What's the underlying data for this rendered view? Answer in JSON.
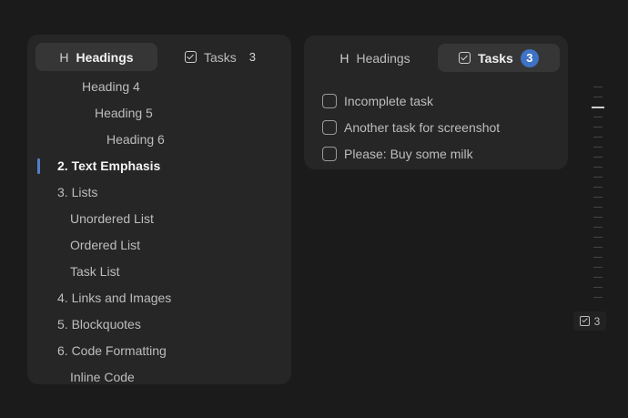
{
  "left_panel": {
    "tabs": [
      {
        "label": "Headings",
        "icon": "heading-icon",
        "glyph": "H",
        "active": true
      },
      {
        "label": "Tasks",
        "icon": "checkbox-icon",
        "count": "3",
        "active": false
      }
    ],
    "outline": [
      {
        "label": "Heading 4",
        "level": 4
      },
      {
        "label": "Heading 5",
        "level": 5
      },
      {
        "label": "Heading 6",
        "level": 6
      },
      {
        "label": "2. Text Emphasis",
        "level": 1,
        "current": true
      },
      {
        "label": "3. Lists",
        "level": 1
      },
      {
        "label": "Unordered List",
        "level": 2
      },
      {
        "label": "Ordered List",
        "level": 2
      },
      {
        "label": "Task List",
        "level": 2
      },
      {
        "label": "4. Links and Images",
        "level": 1
      },
      {
        "label": "5. Blockquotes",
        "level": 1
      },
      {
        "label": "6. Code Formatting",
        "level": 1
      },
      {
        "label": "Inline Code",
        "level": 2
      }
    ]
  },
  "right_panel": {
    "tabs": [
      {
        "label": "Headings",
        "icon": "heading-icon",
        "glyph": "H",
        "active": false
      },
      {
        "label": "Tasks",
        "icon": "checkbox-icon",
        "count": "3",
        "active": true
      }
    ],
    "tasks": [
      {
        "label": "Incomplete task",
        "checked": false
      },
      {
        "label": "Another task for screenshot",
        "checked": false
      },
      {
        "label": "Please: Buy some milk",
        "checked": false
      }
    ]
  },
  "minimap": {
    "mini_tasks_count": "3"
  },
  "colors": {
    "background": "#1b1b1b",
    "panel": "#262626",
    "active_tab": "#363636",
    "accent": "#3d72c4",
    "text": "#bdbdbd"
  }
}
